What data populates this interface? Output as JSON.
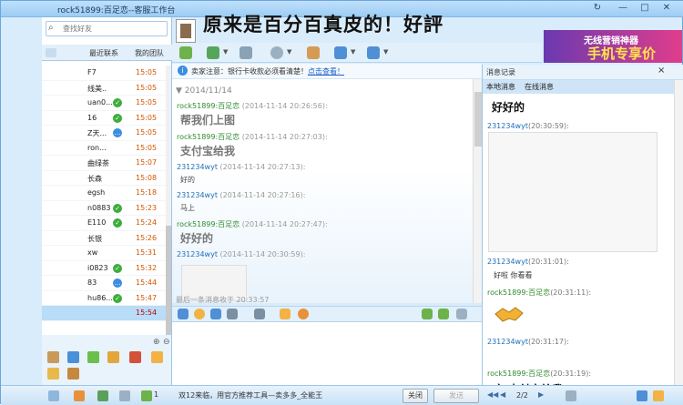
{
  "window": {
    "title": "rock51899:百足恋--客服工作台",
    "overlay_title": "原来是百分百真皮的！好評",
    "controls": [
      "↻",
      "—",
      "□",
      "✕"
    ]
  },
  "search": {
    "placeholder": "查找好友"
  },
  "left_tabs": [
    "最近联系",
    "我的团队"
  ],
  "contacts": [
    {
      "name": "F7",
      "time": "15:05",
      "badge": ""
    },
    {
      "name": "线美..",
      "time": "15:05",
      "badge": ""
    },
    {
      "name": "uan0...",
      "time": "15:05",
      "badge": "ok"
    },
    {
      "name": "16",
      "time": "15:05",
      "badge": "ok"
    },
    {
      "name": "Z天...",
      "time": "15:05",
      "badge": "msg"
    },
    {
      "name": "ron...",
      "time": "15:05",
      "badge": ""
    },
    {
      "name": "曲绿茶",
      "time": "15:07",
      "badge": ""
    },
    {
      "name": "长森",
      "time": "15:08",
      "badge": ""
    },
    {
      "name": "egsh",
      "time": "15:18",
      "badge": ""
    },
    {
      "name": "n0883",
      "time": "15:23",
      "badge": "ok"
    },
    {
      "name": "E110",
      "time": "15:24",
      "badge": "ok"
    },
    {
      "name": "长银",
      "time": "15:26",
      "badge": ""
    },
    {
      "name": "xw",
      "time": "15:31",
      "badge": ""
    },
    {
      "name": "i0823",
      "time": "15:32",
      "badge": "ok"
    },
    {
      "name": "83",
      "time": "15:44",
      "badge": "msg"
    },
    {
      "name": "hu86...",
      "time": "15:47",
      "badge": "ok"
    },
    {
      "name": "",
      "time": "15:54",
      "badge": ""
    }
  ],
  "banner": {
    "line1": "无线营销神器",
    "line2": "手机专享价"
  },
  "notice": {
    "text": "卖家注意：银行卡收款必须看清楚！",
    "link": "点击查看！"
  },
  "chat": {
    "date": "2014/11/14",
    "messages": [
      {
        "sender": "rock51899:百足恋",
        "time": "(2014-11-14 20:26:56):",
        "body": "帮我们上图",
        "big": true,
        "role": "seller"
      },
      {
        "sender": "rock51899:百足恋",
        "time": "(2014-11-14 20:27:03):",
        "body": "支付宝给我",
        "big": true,
        "role": "seller"
      },
      {
        "sender": "231234wyt",
        "time": "(2014-11-14 20:27:13):",
        "body": "好的",
        "big": false,
        "role": "buyer"
      },
      {
        "sender": "231234wyt",
        "time": "(2014-11-14 20:27:16):",
        "body": "马上",
        "big": false,
        "role": "buyer"
      },
      {
        "sender": "rock51899:百足恋",
        "time": "(2014-11-14 20:27:47):",
        "body": "好好的",
        "big": true,
        "role": "seller"
      },
      {
        "sender": "231234wyt",
        "time": "(2014-11-14 20:30:59):",
        "body": "",
        "big": false,
        "role": "buyer"
      }
    ],
    "history": "最后一条消息收于 20:33:57"
  },
  "right": {
    "header": "消息记录",
    "close": "×",
    "tabs": [
      "本地消息",
      "在线消息"
    ],
    "entries": [
      {
        "sender": "",
        "time": "",
        "body": "好好的",
        "big": true,
        "role": "seller"
      },
      {
        "sender": "231234wyt",
        "time": "(20:30:59):",
        "body": "",
        "big": false,
        "role": "buyer"
      },
      {
        "sender": "231234wyt",
        "time": "(20:31:01):",
        "body": "好啦 你看看",
        "big": false,
        "role": "buyer"
      },
      {
        "sender": "rock51899:百足恋",
        "time": "(20:31:11):",
        "body": "",
        "big": false,
        "role": "seller"
      },
      {
        "sender": "231234wyt",
        "time": "(20:31:17):",
        "body": "",
        "big": false,
        "role": "buyer"
      },
      {
        "sender": "rock51899:百足恋",
        "time": "(20:31:19):",
        "body": "亲 支付宝给我",
        "big": true,
        "role": "seller"
      }
    ]
  },
  "status": {
    "count": "1",
    "promo": "双12来临，用官方推荐工具—卖多多_全能王",
    "close_btn": "关闭",
    "send_btn": "发送",
    "page": "2/2"
  },
  "colors": {
    "accent": "#3b8ee0",
    "seller": "#2e8b2e",
    "buyer": "#1e6fb8",
    "time": "#d35400"
  }
}
